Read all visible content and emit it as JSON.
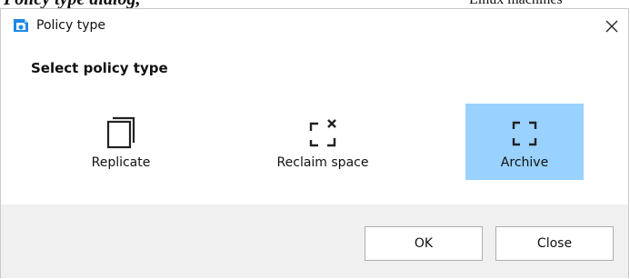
{
  "background": {
    "left_fragment": "Policy type dialog,",
    "right_fragment": "Linux machines"
  },
  "dialog": {
    "title": "Policy type",
    "close_glyph": "✕",
    "heading": "Select policy type"
  },
  "options": [
    {
      "label": "Replicate",
      "icon": "replicate-icon",
      "selected": false
    },
    {
      "label": "Reclaim space",
      "icon": "reclaim-space-icon",
      "selected": false
    },
    {
      "label": "Archive",
      "icon": "archive-icon",
      "selected": true
    }
  ],
  "buttons": {
    "ok": "OK",
    "close": "Close"
  },
  "colors": {
    "selected_bg": "#99d1ff",
    "footer_bg": "#f0f0f0",
    "icon_blue": "#1e88e5"
  }
}
